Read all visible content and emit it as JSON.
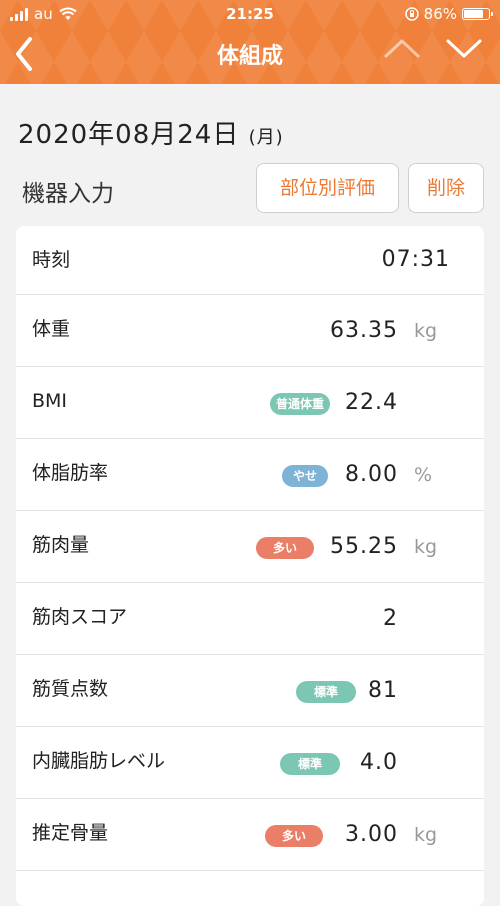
{
  "status_bar": {
    "carrier": "au",
    "time": "21:25",
    "battery": "86%",
    "battery_level": 0.86
  },
  "nav": {
    "title": "体組成",
    "icons": [
      "chevron-left-icon",
      "chevron-up-icon",
      "chevron-down-icon"
    ]
  },
  "date": {
    "main": "2020年08月24日",
    "weekday": "(月)"
  },
  "section": {
    "title": "機器入力",
    "detail_button": "部位別評価",
    "delete_button": "削除"
  },
  "colors": {
    "accent": "#f0813a",
    "badge_teal": "#7cc7b3",
    "badge_blue": "#7fb3d5",
    "badge_red": "#eb7e66"
  },
  "rows": [
    {
      "label": "時刻",
      "value": "07:31"
    },
    {
      "label": "体重",
      "value": "63.35",
      "unit": "kg"
    },
    {
      "label": "BMI",
      "badge": "普通体重",
      "value": "22.4"
    },
    {
      "label": "体脂肪率",
      "badge": "やせ",
      "value": "8.00",
      "unit": "%"
    },
    {
      "label": "筋肉量",
      "badge": "多い",
      "value": "55.25",
      "unit": "kg"
    },
    {
      "label": "筋肉スコア",
      "value": "2"
    },
    {
      "label": "筋質点数",
      "badge": "標準",
      "value": "81"
    },
    {
      "label": "内臓脂肪レベル",
      "badge": "標準",
      "value": "4.0"
    },
    {
      "label": "推定骨量",
      "badge": "多い",
      "value": "3.00",
      "unit": "kg"
    }
  ]
}
